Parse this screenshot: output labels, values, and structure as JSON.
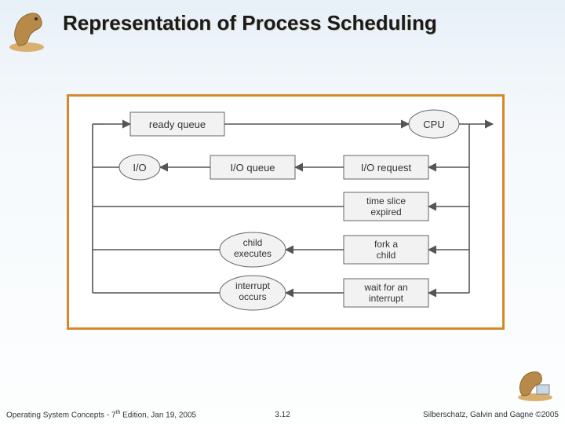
{
  "title": "Representation of Process Scheduling",
  "footer": {
    "left_prefix": "Operating System Concepts - 7",
    "left_sup": "th",
    "left_suffix": " Edition, Jan 19, 2005",
    "center": "3.12",
    "right_prefix": "Silberschatz, Galvin and Gagne ",
    "right_copy": "©",
    "right_year": "2005"
  },
  "diagram": {
    "nodes": {
      "ready_queue": "ready queue",
      "cpu": "CPU",
      "io": "I/O",
      "io_queue": "I/O queue",
      "io_request": "I/O request",
      "time_slice_l1": "time slice",
      "time_slice_l2": "expired",
      "child_exec_l1": "child",
      "child_exec_l2": "executes",
      "fork_l1": "fork a",
      "fork_l2": "child",
      "interrupt_occ_l1": "interrupt",
      "interrupt_occ_l2": "occurs",
      "wait_int_l1": "wait for an",
      "wait_int_l2": "interrupt"
    }
  }
}
